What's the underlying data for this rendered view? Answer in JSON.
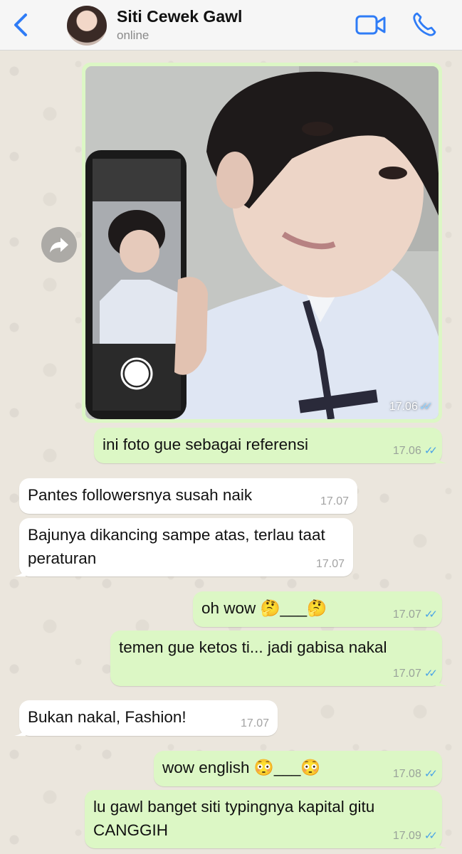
{
  "header": {
    "contact_name": "Siti Cewek Gawl",
    "status": "online",
    "back_icon": "chevron-left-icon",
    "video_icon": "video-camera-icon",
    "call_icon": "phone-icon",
    "accent": "#2f7cf6"
  },
  "messages": [
    {
      "type": "photo",
      "direction": "out",
      "time": "17.06",
      "ticks": "✓✓"
    },
    {
      "type": "text",
      "direction": "out",
      "text": "ini foto gue sebagai referensi",
      "time": "17.06",
      "ticks": "✓✓"
    },
    {
      "type": "text",
      "direction": "in",
      "text": "Pantes followersnya susah naik",
      "time": "17.07"
    },
    {
      "type": "text",
      "direction": "in",
      "text": "Bajunya dikancing sampe atas, terlau taat peraturan",
      "time": "17.07"
    },
    {
      "type": "text",
      "direction": "out",
      "text": "oh wow 🤔___🤔",
      "time": "17.07",
      "ticks": "✓✓"
    },
    {
      "type": "text",
      "direction": "out",
      "text": "temen gue ketos ti... jadi gabisa nakal",
      "time": "17.07",
      "ticks": "✓✓"
    },
    {
      "type": "text",
      "direction": "in",
      "text": "Bukan nakal, Fashion!",
      "time": "17.07"
    },
    {
      "type": "text",
      "direction": "out",
      "text": "wow english 😳___😳",
      "time": "17.08",
      "ticks": "✓✓"
    },
    {
      "type": "text",
      "direction": "out",
      "text": "lu gawl banget siti typingnya kapital gitu CANGGIH",
      "time": "17.09",
      "ticks": "✓✓"
    }
  ],
  "colors": {
    "outgoing_bubble": "#dcf7c5",
    "incoming_bubble": "#ffffff",
    "read_ticks": "#4aa3e6"
  }
}
